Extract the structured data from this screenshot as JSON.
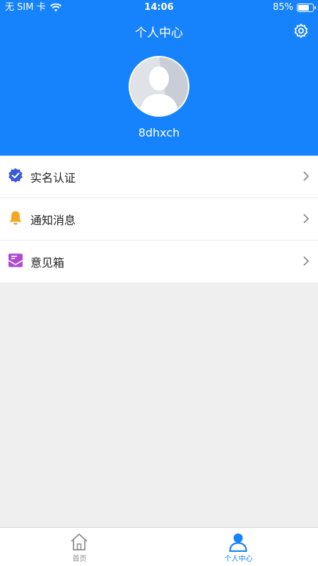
{
  "status_bar": {
    "carrier": "无 SIM 卡",
    "time": "14:06",
    "battery": "85%",
    "battery_level": 0.85
  },
  "header": {
    "title": "个人中心",
    "username": "8dhxch",
    "settings_icon": "gear-icon"
  },
  "menu": [
    {
      "label": "实名认证",
      "icon": "verified-badge-icon",
      "color": "#3a5bd9"
    },
    {
      "label": "通知消息",
      "icon": "bell-icon",
      "color": "#f5a623"
    },
    {
      "label": "意见箱",
      "icon": "mailbox-icon",
      "color": "#b04bd1"
    }
  ],
  "tabbar": {
    "tabs": [
      {
        "label": "首页",
        "icon": "home-icon",
        "active": false
      },
      {
        "label": "个人中心",
        "icon": "person-icon",
        "active": true
      }
    ]
  },
  "colors": {
    "primary": "#1682fb",
    "background": "#efefef",
    "inactive_tab": "#8f8f8f"
  }
}
